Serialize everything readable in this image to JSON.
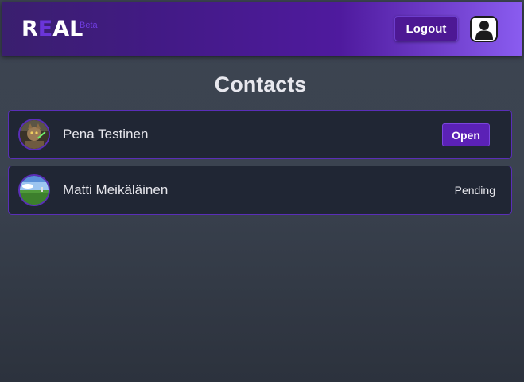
{
  "header": {
    "logo_first": "R",
    "logo_accent": "E",
    "logo_rest": "AL",
    "beta_label": "Beta",
    "logout_label": "Logout",
    "profile_icon": "user-silhouette-icon"
  },
  "page": {
    "title": "Contacts"
  },
  "contacts": [
    {
      "name": "Pena Testinen",
      "action_label": "Open",
      "avatar": "cat-lightsaber-photo"
    },
    {
      "name": "Matti Meikäläinen",
      "status_label": "Pending",
      "avatar": "landscape-photo"
    }
  ],
  "colors": {
    "accent": "#5b21b6",
    "header_start": "#3a1f6e",
    "header_end": "#8a5cf0",
    "card_bg": "#202634",
    "card_border": "#5a2eb8"
  }
}
